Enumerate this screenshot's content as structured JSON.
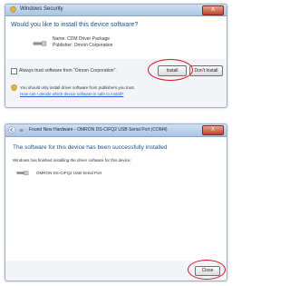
{
  "dialog1": {
    "title": "Windows Security",
    "close_label": "X",
    "heading": "Would you like to install this device software?",
    "name_line": "Name: CDM Driver Package",
    "publisher_line": "Publisher: Omron Corporation",
    "always_trust": "Always trust software from \"Omron Corporation\".",
    "install_label": "Install",
    "dont_install_label": "Don't Install",
    "warning_text": "You should only install driver software from publishers you trust.",
    "warning_link": "How can I decide which device software is safe to install?"
  },
  "dialog2": {
    "title": "Found New Hardware - OMRON DS-CIFQ2 USB Serial Port (COM4)",
    "close_label": "X",
    "heading": "The software for this device has been successfully installed",
    "subtext": "Windows has finished installing the driver software for this device:",
    "device_name": "OMRON DS-CIFQ2 USB Serial Port",
    "close_button_label": "Close"
  },
  "colors": {
    "accent": "#1f4e8c",
    "highlight": "#d8141c",
    "close": "#c0452c"
  }
}
